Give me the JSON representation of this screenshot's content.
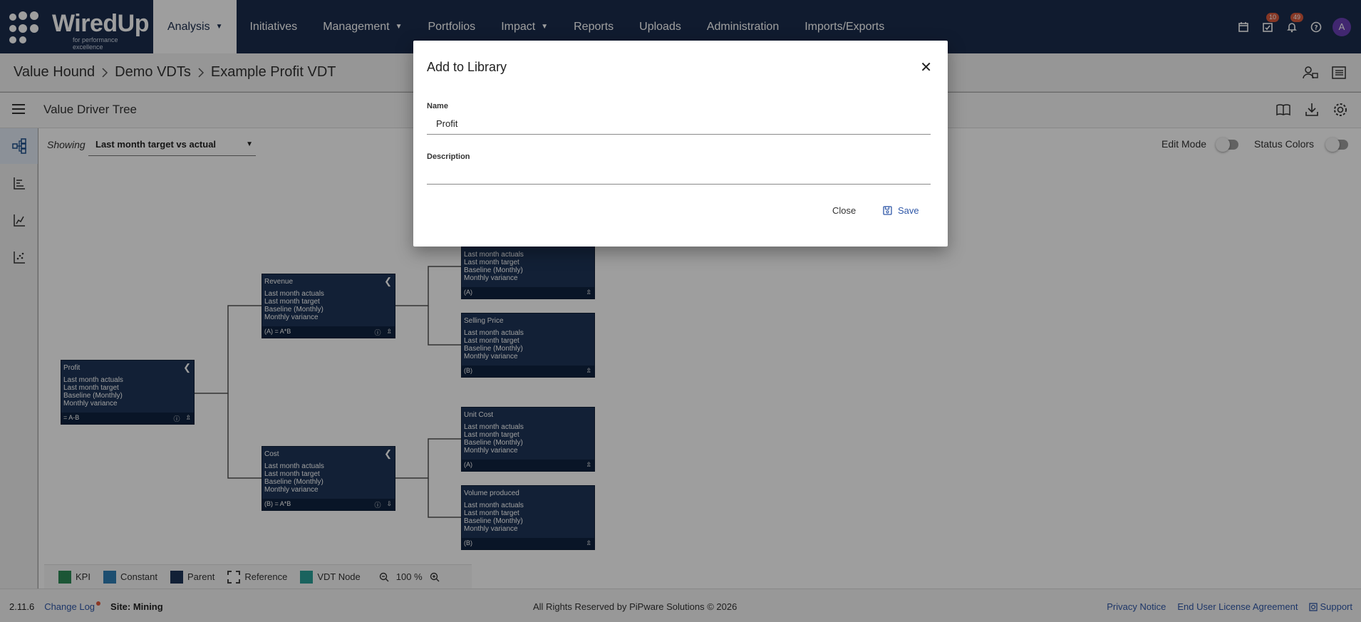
{
  "app": {
    "logo_text": "WiredUp",
    "logo_tagline": "for performance excellence"
  },
  "nav": {
    "items": [
      {
        "label": "Analysis",
        "dropdown": true,
        "active": true
      },
      {
        "label": "Initiatives",
        "dropdown": false
      },
      {
        "label": "Management",
        "dropdown": true
      },
      {
        "label": "Portfolios",
        "dropdown": false
      },
      {
        "label": "Impact",
        "dropdown": true
      },
      {
        "label": "Reports",
        "dropdown": false
      },
      {
        "label": "Uploads",
        "dropdown": false
      },
      {
        "label": "Administration",
        "dropdown": false
      },
      {
        "label": "Imports/Exports",
        "dropdown": false
      }
    ],
    "tasks_badge": "10",
    "notifications_badge": "49",
    "avatar_initial": "A"
  },
  "breadcrumb": [
    "Value Hound",
    "Demo VDTs",
    "Example Profit VDT"
  ],
  "page": {
    "title": "Value Driver Tree",
    "showing_label": "Showing",
    "showing_value": "Last month target vs actual",
    "edit_mode_label": "Edit Mode",
    "status_colors_label": "Status Colors"
  },
  "tree": {
    "nodes": [
      {
        "title": "Profit",
        "lines": [
          "Last month actuals",
          "Last month target",
          "Baseline (Monthly)",
          "Monthly variance"
        ],
        "formula": "= A-B"
      },
      {
        "title": "Revenue",
        "lines": [
          "Last month actuals",
          "Last month target",
          "Baseline (Monthly)",
          "Monthly variance"
        ],
        "formula": "(A) = A*B"
      },
      {
        "title": "",
        "lines": [
          "Last month actuals",
          "Last month target",
          "Baseline (Monthly)",
          "Monthly variance"
        ],
        "formula": "(A)"
      },
      {
        "title": "Selling Price",
        "lines": [
          "Last month actuals",
          "Last month target",
          "Baseline (Monthly)",
          "Monthly variance"
        ],
        "formula": "(B)"
      },
      {
        "title": "Cost",
        "lines": [
          "Last month actuals",
          "Last month target",
          "Baseline (Monthly)",
          "Monthly variance"
        ],
        "formula": "(B) = A*B"
      },
      {
        "title": "Unit Cost",
        "lines": [
          "Last month actuals",
          "Last month target",
          "Baseline (Monthly)",
          "Monthly variance"
        ],
        "formula": "(A)"
      },
      {
        "title": "Volume produced",
        "lines": [
          "Last month actuals",
          "Last month target",
          "Baseline (Monthly)",
          "Monthly variance"
        ],
        "formula": "(B)"
      }
    ]
  },
  "legend": {
    "items": [
      {
        "label": "KPI",
        "color": "#2e8b57"
      },
      {
        "label": "Constant",
        "color": "#2f7fb5"
      },
      {
        "label": "Parent",
        "color": "#1d3557"
      },
      {
        "label": "Reference",
        "color": "#dashed"
      },
      {
        "label": "VDT Node",
        "color": "#2aa198"
      }
    ],
    "zoom": "100 %"
  },
  "footer": {
    "version": "2.11.6",
    "change_log": "Change Log",
    "site": "Site: Mining",
    "copyright": "All Rights Reserved by PiPware Solutions © 2026",
    "privacy": "Privacy Notice",
    "eula": "End User License Agreement",
    "support": "Support"
  },
  "modal": {
    "title": "Add to Library",
    "name_label": "Name",
    "name_value": "Profit",
    "description_label": "Description",
    "description_value": "",
    "close_label": "Close",
    "save_label": "Save"
  }
}
